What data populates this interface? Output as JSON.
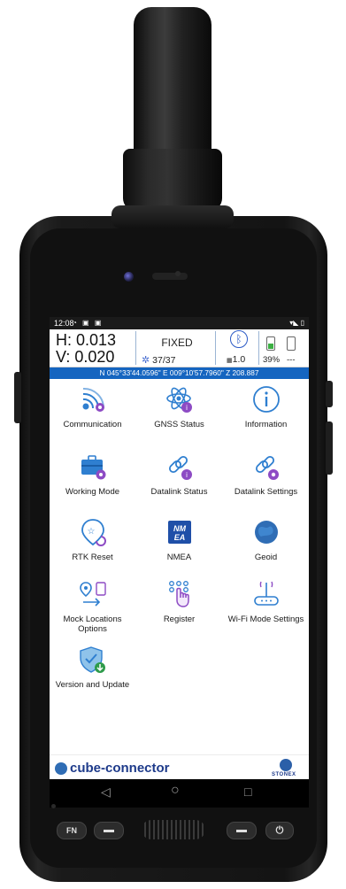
{
  "status_bar": {
    "time": "12:08",
    "notification_icons": "◔ ▣ ▣",
    "right_icons": "▾◣ ▯"
  },
  "gnss": {
    "h_precision": "H: 0.013",
    "v_precision": "V: 0.020",
    "solution": "FIXED",
    "satellites": "37/37",
    "correction_age": "1.0",
    "battery_percent": "39%",
    "battery2": "---",
    "coordinates": "N 045°33'44.0596\" E 009°10'57.7960\" Z 208.887"
  },
  "menu_items": [
    {
      "label": "Communication",
      "icon": "communication-icon"
    },
    {
      "label": "GNSS Status",
      "icon": "gnss-status-icon"
    },
    {
      "label": "Information",
      "icon": "information-icon"
    },
    {
      "label": "Working Mode",
      "icon": "working-mode-icon"
    },
    {
      "label": "Datalink Status",
      "icon": "datalink-status-icon"
    },
    {
      "label": "Datalink Settings",
      "icon": "datalink-settings-icon"
    },
    {
      "label": "RTK Reset",
      "icon": "rtk-reset-icon"
    },
    {
      "label": "NMEA",
      "icon": "nmea-icon"
    },
    {
      "label": "Geoid",
      "icon": "geoid-icon"
    },
    {
      "label": "Mock Locations Options",
      "icon": "mock-locations-icon"
    },
    {
      "label": "Register",
      "icon": "register-icon"
    },
    {
      "label": "Wi-Fi Mode Settings",
      "icon": "wifi-mode-icon"
    },
    {
      "label": "Version and Update",
      "icon": "version-update-icon"
    }
  ],
  "brand": {
    "app_name_part1": "cube",
    "app_name_part2": "-connector",
    "maker": "STONEX"
  },
  "nav": {
    "back": "◁",
    "home": "○",
    "recents": "□"
  },
  "hardware_keys": {
    "fn": "FN",
    "power": "⏻"
  },
  "colors": {
    "accent_blue": "#1565c0",
    "icon_blue": "#2f7fd0",
    "icon_purple": "#8d4bc4",
    "battery_green": "#3cb043"
  }
}
